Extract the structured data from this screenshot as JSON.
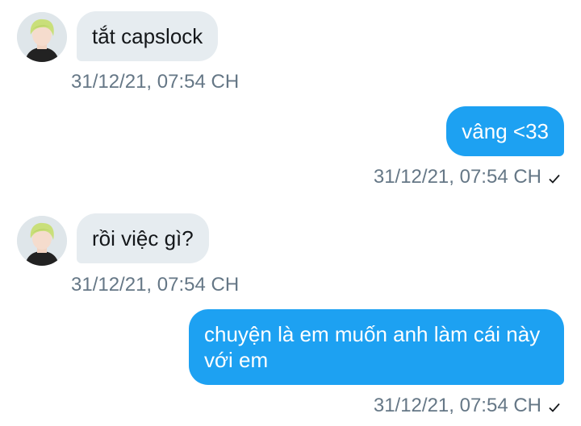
{
  "messages": [
    {
      "direction": "incoming",
      "text": "tắt capslock",
      "timestamp": "31/12/21, 07:54 CH",
      "avatar_icon": "user-avatar"
    },
    {
      "direction": "outgoing",
      "text": "vâng <33",
      "timestamp": "31/12/21, 07:54 CH",
      "status_icon": "checkmark-icon"
    },
    {
      "direction": "incoming",
      "text": "rồi việc gì?",
      "timestamp": "31/12/21, 07:54 CH",
      "avatar_icon": "user-avatar"
    },
    {
      "direction": "outgoing",
      "text": "chuyện là em muốn anh làm cái này với em",
      "timestamp": "31/12/21, 07:54 CH",
      "status_icon": "checkmark-icon"
    }
  ],
  "colors": {
    "incoming_bubble": "#e6ecf0",
    "outgoing_bubble": "#1da1f2",
    "timestamp": "#657786",
    "incoming_text": "#14171a",
    "outgoing_text": "#ffffff"
  }
}
